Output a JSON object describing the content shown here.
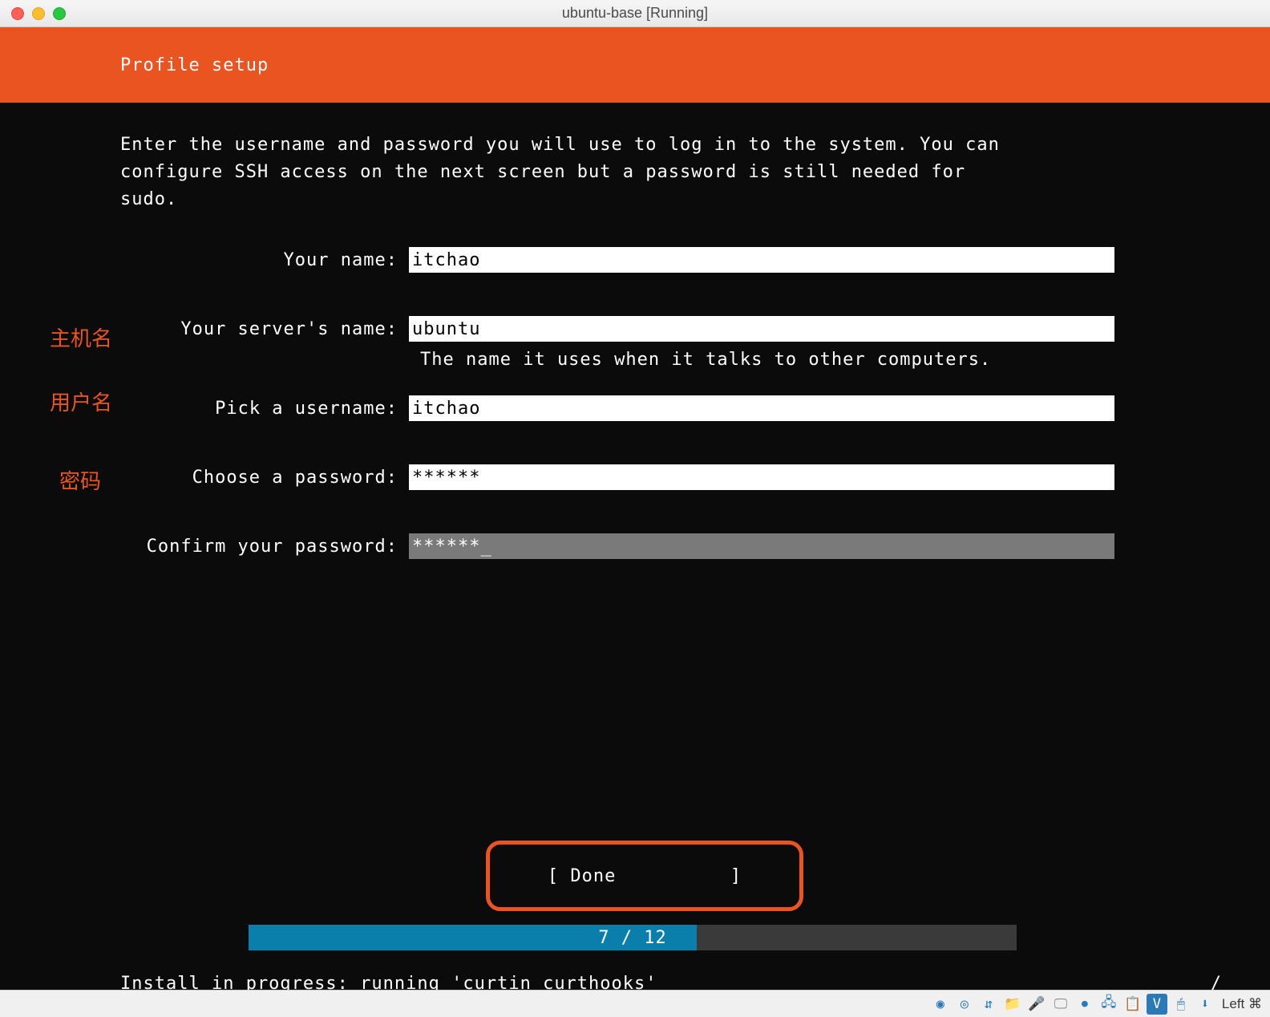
{
  "window": {
    "title": "ubuntu-base [Running]"
  },
  "header": {
    "title": "Profile setup"
  },
  "intro_text": "Enter the username and password you will use to log in to the system. You can\nconfigure SSH access on the next screen but a password is still needed for\nsudo.",
  "annotations": {
    "hostname": "主机名",
    "username": "用户名",
    "password": "密码"
  },
  "fields": {
    "your_name": {
      "label": "Your name:",
      "value": "itchao"
    },
    "server_name": {
      "label": "Your server's name:",
      "value": "ubuntu",
      "hint": "The name it uses when it talks to other computers."
    },
    "pick_username": {
      "label": "Pick a username:",
      "value": "itchao"
    },
    "choose_password": {
      "label": "Choose a password:",
      "value": "******"
    },
    "confirm_password": {
      "label": "Confirm your password:",
      "value": "******"
    }
  },
  "done_button": "[ Done          ]",
  "progress": {
    "text": "7 / 12",
    "current": 7,
    "total": 12
  },
  "status": {
    "text": "Install in progress: running 'curtin curthooks'",
    "spinner": "/"
  },
  "bottom_bar": {
    "host_key": "Left ⌘"
  }
}
